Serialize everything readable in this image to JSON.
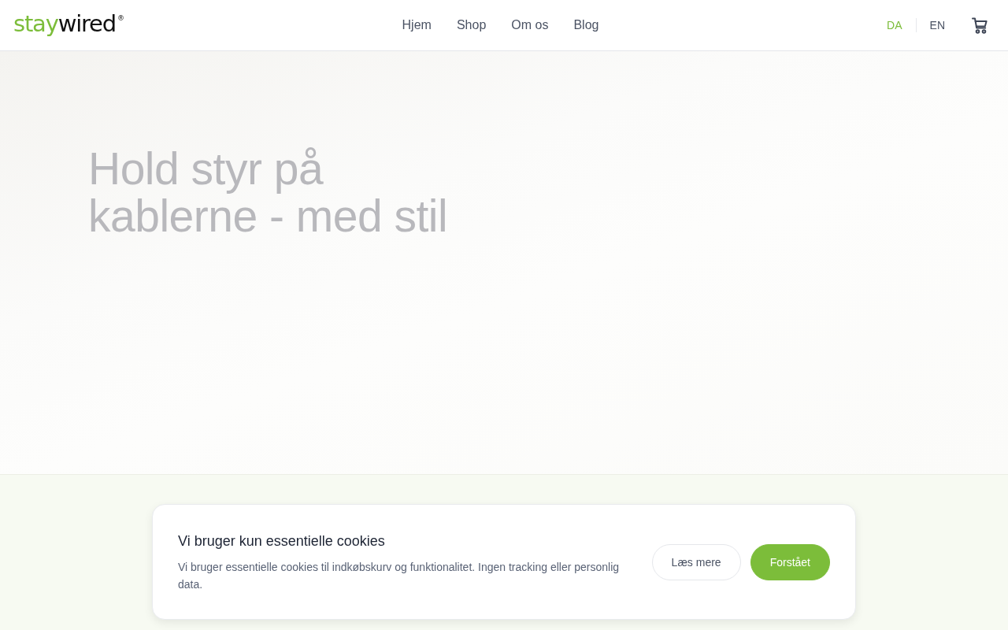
{
  "header": {
    "logo": {
      "part_1": "stay",
      "part_2": "wired",
      "mark": "®"
    },
    "nav": [
      {
        "label": "Hjem"
      },
      {
        "label": "Shop"
      },
      {
        "label": "Om os"
      },
      {
        "label": "Blog"
      }
    ],
    "languages": [
      {
        "label": "DA",
        "selected": true
      },
      {
        "label": "EN",
        "selected": false
      }
    ]
  },
  "hero": {
    "title_lines": [
      "Hold styr på",
      "kablerne - med stil"
    ]
  },
  "cookie_banner": {
    "title": "Vi bruger kun essentielle cookies",
    "text": "Vi bruger essentielle cookies til indkøbskurv og funktionalitet. Ingen tracking eller personlig data.",
    "buttons": [
      {
        "label": "Læs mere",
        "kind": "secondary"
      },
      {
        "label": "Forstået",
        "kind": "primary"
      }
    ]
  }
}
